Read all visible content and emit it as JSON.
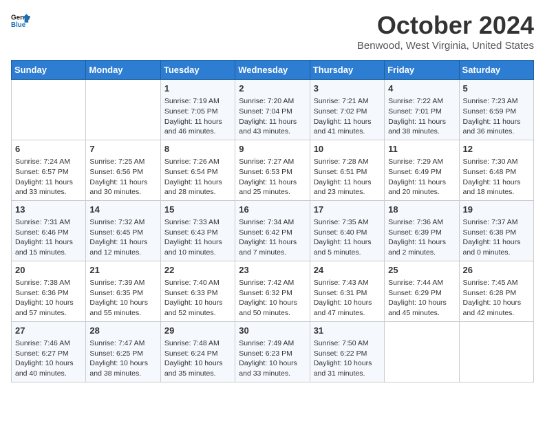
{
  "header": {
    "logo_line1": "General",
    "logo_line2": "Blue",
    "month": "October 2024",
    "location": "Benwood, West Virginia, United States"
  },
  "days_of_week": [
    "Sunday",
    "Monday",
    "Tuesday",
    "Wednesday",
    "Thursday",
    "Friday",
    "Saturday"
  ],
  "weeks": [
    [
      {
        "day": "",
        "info": ""
      },
      {
        "day": "",
        "info": ""
      },
      {
        "day": "1",
        "info": "Sunrise: 7:19 AM\nSunset: 7:05 PM\nDaylight: 11 hours and 46 minutes."
      },
      {
        "day": "2",
        "info": "Sunrise: 7:20 AM\nSunset: 7:04 PM\nDaylight: 11 hours and 43 minutes."
      },
      {
        "day": "3",
        "info": "Sunrise: 7:21 AM\nSunset: 7:02 PM\nDaylight: 11 hours and 41 minutes."
      },
      {
        "day": "4",
        "info": "Sunrise: 7:22 AM\nSunset: 7:01 PM\nDaylight: 11 hours and 38 minutes."
      },
      {
        "day": "5",
        "info": "Sunrise: 7:23 AM\nSunset: 6:59 PM\nDaylight: 11 hours and 36 minutes."
      }
    ],
    [
      {
        "day": "6",
        "info": "Sunrise: 7:24 AM\nSunset: 6:57 PM\nDaylight: 11 hours and 33 minutes."
      },
      {
        "day": "7",
        "info": "Sunrise: 7:25 AM\nSunset: 6:56 PM\nDaylight: 11 hours and 30 minutes."
      },
      {
        "day": "8",
        "info": "Sunrise: 7:26 AM\nSunset: 6:54 PM\nDaylight: 11 hours and 28 minutes."
      },
      {
        "day": "9",
        "info": "Sunrise: 7:27 AM\nSunset: 6:53 PM\nDaylight: 11 hours and 25 minutes."
      },
      {
        "day": "10",
        "info": "Sunrise: 7:28 AM\nSunset: 6:51 PM\nDaylight: 11 hours and 23 minutes."
      },
      {
        "day": "11",
        "info": "Sunrise: 7:29 AM\nSunset: 6:49 PM\nDaylight: 11 hours and 20 minutes."
      },
      {
        "day": "12",
        "info": "Sunrise: 7:30 AM\nSunset: 6:48 PM\nDaylight: 11 hours and 18 minutes."
      }
    ],
    [
      {
        "day": "13",
        "info": "Sunrise: 7:31 AM\nSunset: 6:46 PM\nDaylight: 11 hours and 15 minutes."
      },
      {
        "day": "14",
        "info": "Sunrise: 7:32 AM\nSunset: 6:45 PM\nDaylight: 11 hours and 12 minutes."
      },
      {
        "day": "15",
        "info": "Sunrise: 7:33 AM\nSunset: 6:43 PM\nDaylight: 11 hours and 10 minutes."
      },
      {
        "day": "16",
        "info": "Sunrise: 7:34 AM\nSunset: 6:42 PM\nDaylight: 11 hours and 7 minutes."
      },
      {
        "day": "17",
        "info": "Sunrise: 7:35 AM\nSunset: 6:40 PM\nDaylight: 11 hours and 5 minutes."
      },
      {
        "day": "18",
        "info": "Sunrise: 7:36 AM\nSunset: 6:39 PM\nDaylight: 11 hours and 2 minutes."
      },
      {
        "day": "19",
        "info": "Sunrise: 7:37 AM\nSunset: 6:38 PM\nDaylight: 11 hours and 0 minutes."
      }
    ],
    [
      {
        "day": "20",
        "info": "Sunrise: 7:38 AM\nSunset: 6:36 PM\nDaylight: 10 hours and 57 minutes."
      },
      {
        "day": "21",
        "info": "Sunrise: 7:39 AM\nSunset: 6:35 PM\nDaylight: 10 hours and 55 minutes."
      },
      {
        "day": "22",
        "info": "Sunrise: 7:40 AM\nSunset: 6:33 PM\nDaylight: 10 hours and 52 minutes."
      },
      {
        "day": "23",
        "info": "Sunrise: 7:42 AM\nSunset: 6:32 PM\nDaylight: 10 hours and 50 minutes."
      },
      {
        "day": "24",
        "info": "Sunrise: 7:43 AM\nSunset: 6:31 PM\nDaylight: 10 hours and 47 minutes."
      },
      {
        "day": "25",
        "info": "Sunrise: 7:44 AM\nSunset: 6:29 PM\nDaylight: 10 hours and 45 minutes."
      },
      {
        "day": "26",
        "info": "Sunrise: 7:45 AM\nSunset: 6:28 PM\nDaylight: 10 hours and 42 minutes."
      }
    ],
    [
      {
        "day": "27",
        "info": "Sunrise: 7:46 AM\nSunset: 6:27 PM\nDaylight: 10 hours and 40 minutes."
      },
      {
        "day": "28",
        "info": "Sunrise: 7:47 AM\nSunset: 6:25 PM\nDaylight: 10 hours and 38 minutes."
      },
      {
        "day": "29",
        "info": "Sunrise: 7:48 AM\nSunset: 6:24 PM\nDaylight: 10 hours and 35 minutes."
      },
      {
        "day": "30",
        "info": "Sunrise: 7:49 AM\nSunset: 6:23 PM\nDaylight: 10 hours and 33 minutes."
      },
      {
        "day": "31",
        "info": "Sunrise: 7:50 AM\nSunset: 6:22 PM\nDaylight: 10 hours and 31 minutes."
      },
      {
        "day": "",
        "info": ""
      },
      {
        "day": "",
        "info": ""
      }
    ]
  ]
}
